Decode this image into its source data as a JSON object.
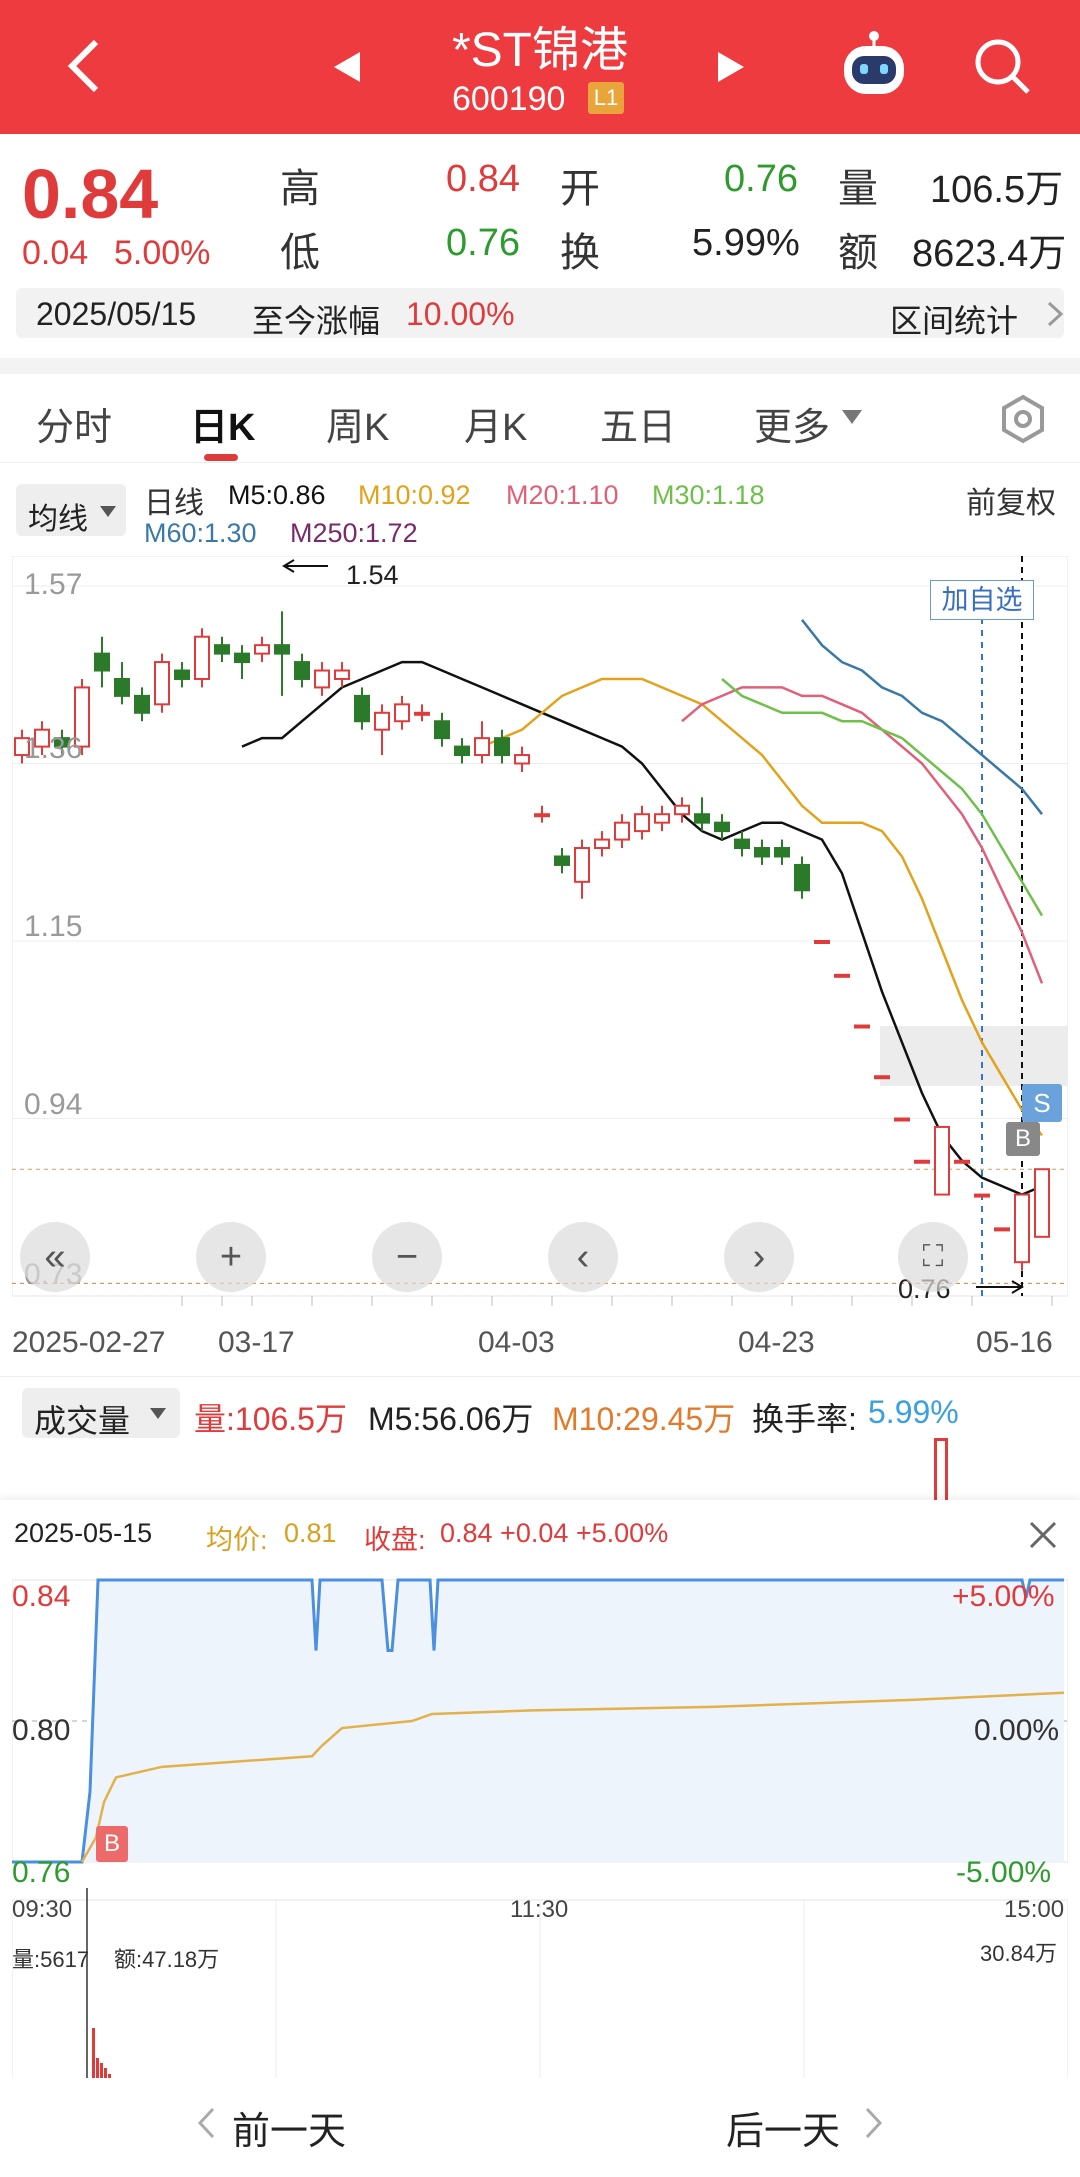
{
  "header": {
    "title": "*ST锦港",
    "code": "600190",
    "level_badge": "L1"
  },
  "quote": {
    "price": "0.84",
    "change": "0.04",
    "change_pct": "5.00%",
    "high_label": "高",
    "high": "0.84",
    "open_label": "开",
    "open": "0.76",
    "volume_label": "量",
    "volume": "106.5万",
    "low_label": "低",
    "low": "0.76",
    "turnover_label": "换",
    "turnover": "5.99%",
    "amount_label": "额",
    "amount": "8623.4万"
  },
  "range": {
    "date": "2025/05/15",
    "since_label": "至今涨幅",
    "since_value": "10.00%",
    "stats_label": "区间统计"
  },
  "tabs": [
    "分时",
    "日K",
    "周K",
    "月K",
    "五日",
    "更多"
  ],
  "ma": {
    "selector": "均线",
    "line_label": "日线",
    "m5": "M5:0.86",
    "m10": "M10:0.92",
    "m20": "M20:1.10",
    "m30": "M30:1.18",
    "m60": "M60:1.30",
    "m250": "M250:1.72",
    "adjust": "前复权",
    "colors": {
      "m5": "#111111",
      "m10": "#e3a21c",
      "m20": "#e0607a",
      "m30": "#6fc04a",
      "m60": "#3a78a8",
      "m250": "#7a2a6a"
    }
  },
  "kchart": {
    "y_ticks": [
      "1.57",
      "1.36",
      "1.15",
      "0.94",
      "0.73"
    ],
    "x_ticks": [
      "2025-02-27",
      "03-17",
      "04-03",
      "04-23",
      "05-16"
    ],
    "max_label": "1.54",
    "min_label": "0.76",
    "add_watch": "加自选",
    "sell_marker": "S",
    "buy_marker": "B"
  },
  "chart_data": {
    "type": "candlestick",
    "y_range": [
      0.73,
      1.57
    ],
    "x_range": [
      "2025-02-27",
      "2025-05-16"
    ],
    "high_mark": 1.54,
    "low_mark": 0.76,
    "candles": [
      {
        "o": 1.37,
        "c": 1.39,
        "h": 1.4,
        "l": 1.36
      },
      {
        "o": 1.38,
        "c": 1.4,
        "h": 1.41,
        "l": 1.37
      },
      {
        "o": 1.39,
        "c": 1.38,
        "h": 1.4,
        "l": 1.37
      },
      {
        "o": 1.38,
        "c": 1.45,
        "h": 1.46,
        "l": 1.37
      },
      {
        "o": 1.49,
        "c": 1.47,
        "h": 1.51,
        "l": 1.45
      },
      {
        "o": 1.46,
        "c": 1.44,
        "h": 1.48,
        "l": 1.43
      },
      {
        "o": 1.44,
        "c": 1.42,
        "h": 1.45,
        "l": 1.41
      },
      {
        "o": 1.43,
        "c": 1.48,
        "h": 1.49,
        "l": 1.42
      },
      {
        "o": 1.47,
        "c": 1.46,
        "h": 1.48,
        "l": 1.45
      },
      {
        "o": 1.46,
        "c": 1.51,
        "h": 1.52,
        "l": 1.45
      },
      {
        "o": 1.5,
        "c": 1.49,
        "h": 1.51,
        "l": 1.48
      },
      {
        "o": 1.49,
        "c": 1.48,
        "h": 1.5,
        "l": 1.46
      },
      {
        "o": 1.49,
        "c": 1.5,
        "h": 1.51,
        "l": 1.48
      },
      {
        "o": 1.5,
        "c": 1.49,
        "h": 1.54,
        "l": 1.44
      },
      {
        "o": 1.48,
        "c": 1.46,
        "h": 1.49,
        "l": 1.45
      },
      {
        "o": 1.45,
        "c": 1.47,
        "h": 1.48,
        "l": 1.44
      },
      {
        "o": 1.46,
        "c": 1.47,
        "h": 1.48,
        "l": 1.45
      },
      {
        "o": 1.44,
        "c": 1.41,
        "h": 1.45,
        "l": 1.4
      },
      {
        "o": 1.4,
        "c": 1.42,
        "h": 1.43,
        "l": 1.37
      },
      {
        "o": 1.41,
        "c": 1.43,
        "h": 1.44,
        "l": 1.4
      },
      {
        "o": 1.42,
        "c": 1.42,
        "h": 1.43,
        "l": 1.41
      },
      {
        "o": 1.41,
        "c": 1.39,
        "h": 1.42,
        "l": 1.38
      },
      {
        "o": 1.38,
        "c": 1.37,
        "h": 1.39,
        "l": 1.36
      },
      {
        "o": 1.37,
        "c": 1.39,
        "h": 1.41,
        "l": 1.36
      },
      {
        "o": 1.39,
        "c": 1.37,
        "h": 1.4,
        "l": 1.36
      },
      {
        "o": 1.36,
        "c": 1.37,
        "h": 1.38,
        "l": 1.35
      },
      {
        "o": 1.3,
        "c": 1.3,
        "h": 1.31,
        "l": 1.29
      },
      {
        "o": 1.25,
        "c": 1.24,
        "h": 1.26,
        "l": 1.23
      },
      {
        "o": 1.22,
        "c": 1.26,
        "h": 1.27,
        "l": 1.2
      },
      {
        "o": 1.26,
        "c": 1.27,
        "h": 1.28,
        "l": 1.25
      },
      {
        "o": 1.27,
        "c": 1.29,
        "h": 1.3,
        "l": 1.26
      },
      {
        "o": 1.28,
        "c": 1.3,
        "h": 1.31,
        "l": 1.27
      },
      {
        "o": 1.29,
        "c": 1.3,
        "h": 1.31,
        "l": 1.28
      },
      {
        "o": 1.3,
        "c": 1.31,
        "h": 1.32,
        "l": 1.29
      },
      {
        "o": 1.3,
        "c": 1.29,
        "h": 1.32,
        "l": 1.28
      },
      {
        "o": 1.29,
        "c": 1.28,
        "h": 1.3,
        "l": 1.27
      },
      {
        "o": 1.27,
        "c": 1.26,
        "h": 1.28,
        "l": 1.25
      },
      {
        "o": 1.26,
        "c": 1.25,
        "h": 1.27,
        "l": 1.24
      },
      {
        "o": 1.26,
        "c": 1.25,
        "h": 1.27,
        "l": 1.24
      },
      {
        "o": 1.24,
        "c": 1.21,
        "h": 1.25,
        "l": 1.2
      },
      {
        "o": 1.15,
        "c": 1.15,
        "h": 1.15,
        "l": 1.15
      },
      {
        "o": 1.11,
        "c": 1.11,
        "h": 1.11,
        "l": 1.11
      },
      {
        "o": 1.05,
        "c": 1.05,
        "h": 1.05,
        "l": 1.05
      },
      {
        "o": 0.99,
        "c": 0.99,
        "h": 0.99,
        "l": 0.99
      },
      {
        "o": 0.94,
        "c": 0.94,
        "h": 0.94,
        "l": 0.94
      },
      {
        "o": 0.89,
        "c": 0.89,
        "h": 0.89,
        "l": 0.89
      },
      {
        "o": 0.85,
        "c": 0.93,
        "h": 0.93,
        "l": 0.85
      },
      {
        "o": 0.89,
        "c": 0.89,
        "h": 0.89,
        "l": 0.89
      },
      {
        "o": 0.85,
        "c": 0.85,
        "h": 0.85,
        "l": 0.85
      },
      {
        "o": 0.81,
        "c": 0.81,
        "h": 0.81,
        "l": 0.81
      },
      {
        "o": 0.77,
        "c": 0.85,
        "h": 0.85,
        "l": 0.76
      },
      {
        "o": 0.8,
        "c": 0.88,
        "h": 0.88,
        "l": 0.8
      }
    ],
    "ma_series": [
      {
        "name": "M5",
        "values": [
          1.38,
          1.39,
          1.39,
          1.41,
          1.43,
          1.45,
          1.46,
          1.47,
          1.48,
          1.48,
          1.47,
          1.46,
          1.45,
          1.44,
          1.43,
          1.42,
          1.41,
          1.4,
          1.39,
          1.38,
          1.36,
          1.33,
          1.3,
          1.28,
          1.27,
          1.28,
          1.29,
          1.29,
          1.28,
          1.27,
          1.23,
          1.16,
          1.09,
          1.03,
          0.97,
          0.92,
          0.89,
          0.87,
          0.86,
          0.85,
          0.86
        ]
      },
      {
        "name": "M10",
        "values": [
          1.38,
          1.39,
          1.4,
          1.42,
          1.44,
          1.45,
          1.46,
          1.46,
          1.46,
          1.45,
          1.44,
          1.43,
          1.41,
          1.39,
          1.37,
          1.34,
          1.31,
          1.29,
          1.29,
          1.29,
          1.28,
          1.25,
          1.2,
          1.14,
          1.08,
          1.03,
          0.99,
          0.95,
          0.92
        ]
      },
      {
        "name": "M20",
        "values": [
          1.41,
          1.43,
          1.44,
          1.45,
          1.45,
          1.45,
          1.44,
          1.44,
          1.43,
          1.42,
          1.4,
          1.38,
          1.36,
          1.33,
          1.3,
          1.26,
          1.21,
          1.16,
          1.1
        ]
      },
      {
        "name": "M30",
        "values": [
          1.46,
          1.44,
          1.43,
          1.42,
          1.42,
          1.42,
          1.41,
          1.41,
          1.4,
          1.39,
          1.37,
          1.35,
          1.33,
          1.3,
          1.26,
          1.22,
          1.18
        ]
      },
      {
        "name": "M60",
        "values": [
          1.53,
          1.5,
          1.48,
          1.47,
          1.45,
          1.44,
          1.42,
          1.41,
          1.39,
          1.37,
          1.35,
          1.33,
          1.3
        ]
      }
    ]
  },
  "volume": {
    "selector": "成交量",
    "amount": "量:106.5万",
    "m5": "M5:56.06万",
    "m10": "M10:29.45万",
    "turnover_label": "换手率:",
    "turnover": "5.99%"
  },
  "intraday": {
    "date": "2025-05-15",
    "avg_label": "均价:",
    "avg": "0.81",
    "close_label": "收盘:",
    "close": "0.84 +0.04 +5.00%",
    "y_left": [
      "0.84",
      "0.80",
      "0.76"
    ],
    "y_right": [
      "+5.00%",
      "0.00%",
      "-5.00%"
    ],
    "x_ticks": [
      "09:30",
      "11:30",
      "15:00"
    ],
    "vol_label": "量:5617",
    "amt_label": "额:47.18万",
    "vol_max": "30.84万",
    "buy_marker": "B"
  },
  "footer": {
    "prev": "前一天",
    "next": "后一天"
  }
}
